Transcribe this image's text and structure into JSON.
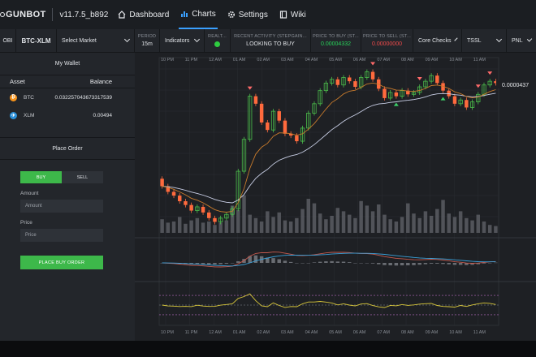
{
  "nav": {
    "brand": "GUNBOT",
    "version": "v11.7.5_b892",
    "items": [
      {
        "label": "Dashboard",
        "icon": "home-icon"
      },
      {
        "label": "Charts",
        "icon": "bar-chart-icon"
      },
      {
        "label": "Settings",
        "icon": "gear-icon"
      },
      {
        "label": "Wiki",
        "icon": "book-icon"
      }
    ],
    "active": "Charts"
  },
  "toolbar": {
    "exchange": "OBI",
    "pair": "BTC-XLM",
    "select_market": "Select Market",
    "period_label": "PERIOD",
    "period_value": "15m",
    "indicators": "Indicators",
    "realtime_label": "REALT...",
    "recent_activity_label": "RECENT ACTIVITY (STEPGAIN...",
    "recent_activity_value": "LOOKING TO BUY",
    "price_buy_label": "PRICE TO BUY (ST...",
    "price_buy_value": "0.00004332",
    "price_sell_label": "PRICE TO SELL (ST...",
    "price_sell_value": "0.00000000",
    "core_checks": "Core Checks",
    "tssl": "TSSL",
    "pnl": "PNL",
    "colors": {
      "buy": "#27d35a",
      "sell": "#f04a4a",
      "status_dot": "#2ecc40"
    }
  },
  "wallet": {
    "title": "My Wallet",
    "col_asset": "Asset",
    "col_balance": "Balance",
    "rows": [
      {
        "asset": "BTC",
        "balance": "0.032257043673317539",
        "icon": "bitcoin-icon"
      },
      {
        "asset": "XLM",
        "balance": "0.00494",
        "icon": "stellar-icon"
      }
    ]
  },
  "order": {
    "title": "Place Order",
    "buy_tab": "BUY",
    "sell_tab": "SELL",
    "amount_label": "Amount",
    "amount_placeholder": "Amount",
    "price_label": "Price",
    "price_placeholder": "Price",
    "place_button": "PLACE BUY ORDER"
  },
  "chart_data": {
    "type": "candlestick",
    "current_price_label": "0.0000437",
    "x_tick_labels": [
      "10 PM",
      "11 PM",
      "12 AM",
      "01 AM",
      "02 AM",
      "03 AM",
      "04 AM",
      "05 AM",
      "06 AM",
      "07 AM",
      "08 AM",
      "09 AM",
      "10 AM",
      "11 AM"
    ],
    "candles": [
      {
        "o": 5.2,
        "c": 4.8
      },
      {
        "o": 4.8,
        "c": 4.5
      },
      {
        "o": 4.5,
        "c": 4.3
      },
      {
        "o": 4.3,
        "c": 4.0
      },
      {
        "o": 4.0,
        "c": 3.8
      },
      {
        "o": 3.8,
        "c": 3.5
      },
      {
        "o": 3.5,
        "c": 3.7
      },
      {
        "o": 3.7,
        "c": 3.4
      },
      {
        "o": 3.4,
        "c": 3.1
      },
      {
        "o": 3.1,
        "c": 2.9
      },
      {
        "o": 2.9,
        "c": 3.1
      },
      {
        "o": 3.1,
        "c": 3.3
      },
      {
        "o": 3.3,
        "c": 3.6
      },
      {
        "o": 3.6,
        "c": 5.6
      },
      {
        "o": 5.6,
        "c": 7.3
      },
      {
        "o": 7.3,
        "c": 9.6
      },
      {
        "o": 9.6,
        "c": 9.2
      },
      {
        "o": 9.2,
        "c": 8.2
      },
      {
        "o": 8.2,
        "c": 7.8
      },
      {
        "o": 7.8,
        "c": 8.8
      },
      {
        "o": 8.8,
        "c": 8.3
      },
      {
        "o": 8.3,
        "c": 7.6
      },
      {
        "o": 7.6,
        "c": 7.5
      },
      {
        "o": 7.5,
        "c": 7.2
      },
      {
        "o": 7.2,
        "c": 7.9
      },
      {
        "o": 7.9,
        "c": 8.7
      },
      {
        "o": 8.7,
        "c": 9.2
      },
      {
        "o": 9.2,
        "c": 9.9
      },
      {
        "o": 9.9,
        "c": 10.3
      },
      {
        "o": 10.3,
        "c": 10.5
      },
      {
        "o": 10.5,
        "c": 10.2
      },
      {
        "o": 10.2,
        "c": 10.6
      },
      {
        "o": 10.6,
        "c": 10.4
      },
      {
        "o": 10.4,
        "c": 10.1
      },
      {
        "o": 10.1,
        "c": 10.6
      },
      {
        "o": 10.6,
        "c": 10.9
      },
      {
        "o": 10.9,
        "c": 10.5
      },
      {
        "o": 10.5,
        "c": 10.0
      },
      {
        "o": 10.0,
        "c": 9.5
      },
      {
        "o": 9.5,
        "c": 9.8
      },
      {
        "o": 9.8,
        "c": 9.6
      },
      {
        "o": 9.6,
        "c": 9.9
      },
      {
        "o": 9.9,
        "c": 9.7
      },
      {
        "o": 9.7,
        "c": 9.8
      },
      {
        "o": 9.8,
        "c": 10.1
      },
      {
        "o": 10.1,
        "c": 10.4
      },
      {
        "o": 10.4,
        "c": 10.7
      },
      {
        "o": 10.7,
        "c": 10.3
      },
      {
        "o": 10.3,
        "c": 9.9
      },
      {
        "o": 9.9,
        "c": 9.6
      },
      {
        "o": 9.6,
        "c": 9.2
      },
      {
        "o": 9.2,
        "c": 9.4
      },
      {
        "o": 9.4,
        "c": 9.0
      },
      {
        "o": 9.0,
        "c": 9.3
      },
      {
        "o": 9.3,
        "c": 9.7
      },
      {
        "o": 9.7,
        "c": 10.2
      },
      {
        "o": 10.2,
        "c": 10.4
      },
      {
        "o": 10.4,
        "c": 10.3
      }
    ],
    "volume": [
      1.2,
      0.9,
      1.0,
      1.4,
      0.8,
      1.1,
      1.3,
      0.9,
      1.0,
      0.7,
      0.9,
      1.1,
      2.4,
      2.0,
      3.3,
      1.6,
      1.3,
      1.0,
      1.9,
      1.4,
      1.8,
      1.1,
      1.0,
      1.3,
      2.1,
      3.0,
      2.6,
      1.7,
      1.2,
      1.5,
      2.2,
      1.9,
      1.6,
      1.3,
      2.8,
      2.4,
      1.9,
      2.5,
      1.6,
      1.2,
      1.0,
      1.4,
      2.6,
      1.7,
      1.3,
      1.9,
      1.5,
      2.1,
      2.9,
      1.7,
      1.4,
      1.9,
      1.3,
      1.1,
      1.6,
      1.0,
      0.7,
      0.6
    ],
    "markers": [
      {
        "index": 15,
        "type": "sell"
      },
      {
        "index": 36,
        "type": "sell"
      },
      {
        "index": 40,
        "type": "buy"
      },
      {
        "index": 44,
        "type": "sell"
      },
      {
        "index": 48,
        "type": "buy"
      },
      {
        "index": 54,
        "type": "sell"
      },
      {
        "index": 56,
        "type": "sell"
      }
    ],
    "colors": {
      "up": "#4bbd4b",
      "down": "#ff6a3d",
      "ema_fast": "#c77a2c",
      "ema_slow": "#c9cfe6",
      "macd_line": "#c4594d",
      "signal_line": "#3aa0d8",
      "rsi": "#d8c73a"
    }
  }
}
